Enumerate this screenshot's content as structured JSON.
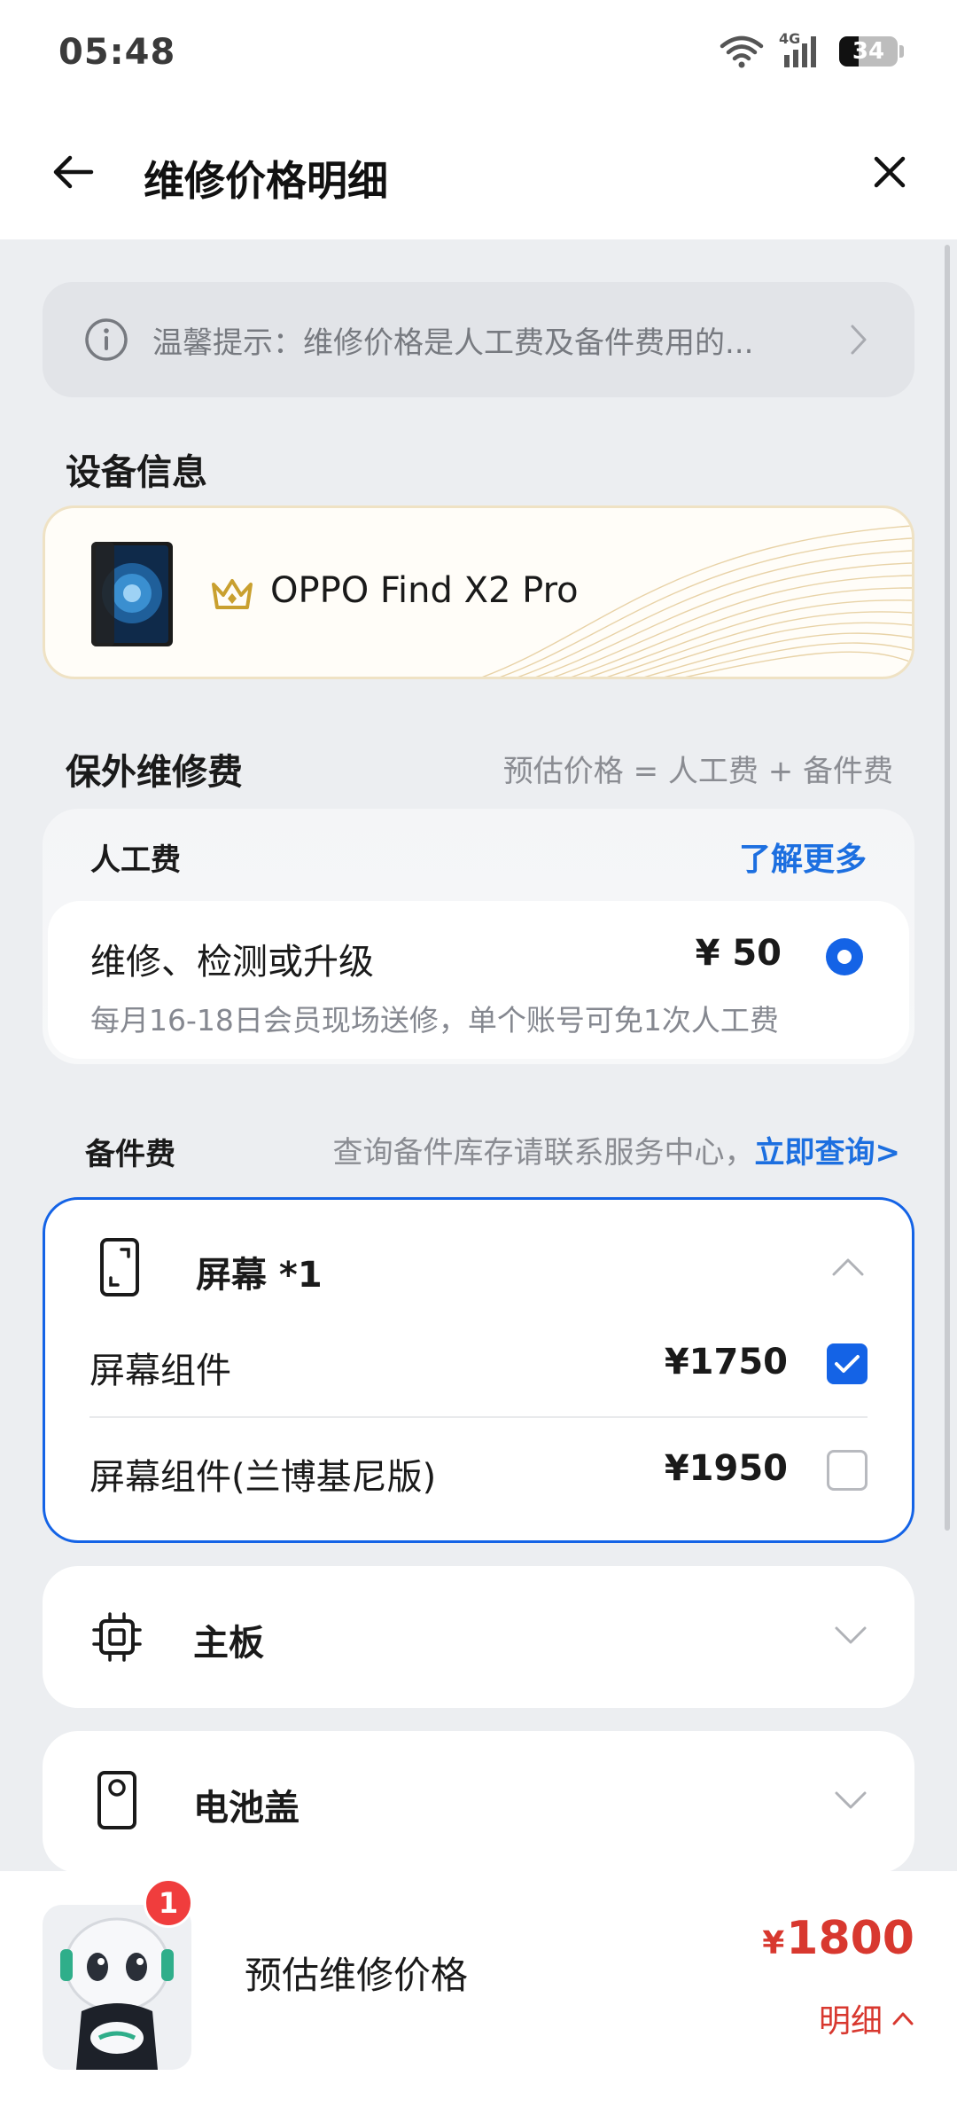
{
  "status_bar": {
    "time": "05:48",
    "battery": "34",
    "network": "4G"
  },
  "header": {
    "title": "维修价格明细"
  },
  "notice": {
    "text": "温馨提示：维修价格是人工费及备件费用的..."
  },
  "device_section": {
    "title": "设备信息",
    "device_name": "OPPO Find X2 Pro"
  },
  "warranty_section": {
    "title": "保外维修费",
    "formula": "预估价格 = 人工费 + 备件费"
  },
  "labor": {
    "header": "人工费",
    "learn_more": "了解更多",
    "option_name": "维修、检测或升级",
    "option_price": "¥ 50",
    "option_note": "每月16-18日会员现场送修，单个账号可免1次人工费",
    "selected": true
  },
  "parts": {
    "label": "备件费",
    "hint": "查询备件库存请联系服务中心，",
    "query_link": "立即查询>"
  },
  "categories": [
    {
      "title": "屏幕 *1",
      "icon": "phone-screen-icon",
      "expanded": true,
      "items": [
        {
          "name": "屏幕组件",
          "price": "¥1750",
          "checked": true
        },
        {
          "name": "屏幕组件(兰博基尼版)",
          "price": "¥1950",
          "checked": false
        }
      ]
    },
    {
      "title": "主板",
      "icon": "chip-icon",
      "expanded": false
    },
    {
      "title": "电池盖",
      "icon": "battery-cover-icon",
      "expanded": false
    }
  ],
  "bottom": {
    "badge": "1",
    "estimate_label": "预估维修价格",
    "currency": "¥",
    "total": "1800",
    "detail_label": "明细"
  },
  "colors": {
    "accent": "#1463e6",
    "link": "#1c6fe0",
    "price": "#d8382f",
    "background": "#eceef1"
  }
}
